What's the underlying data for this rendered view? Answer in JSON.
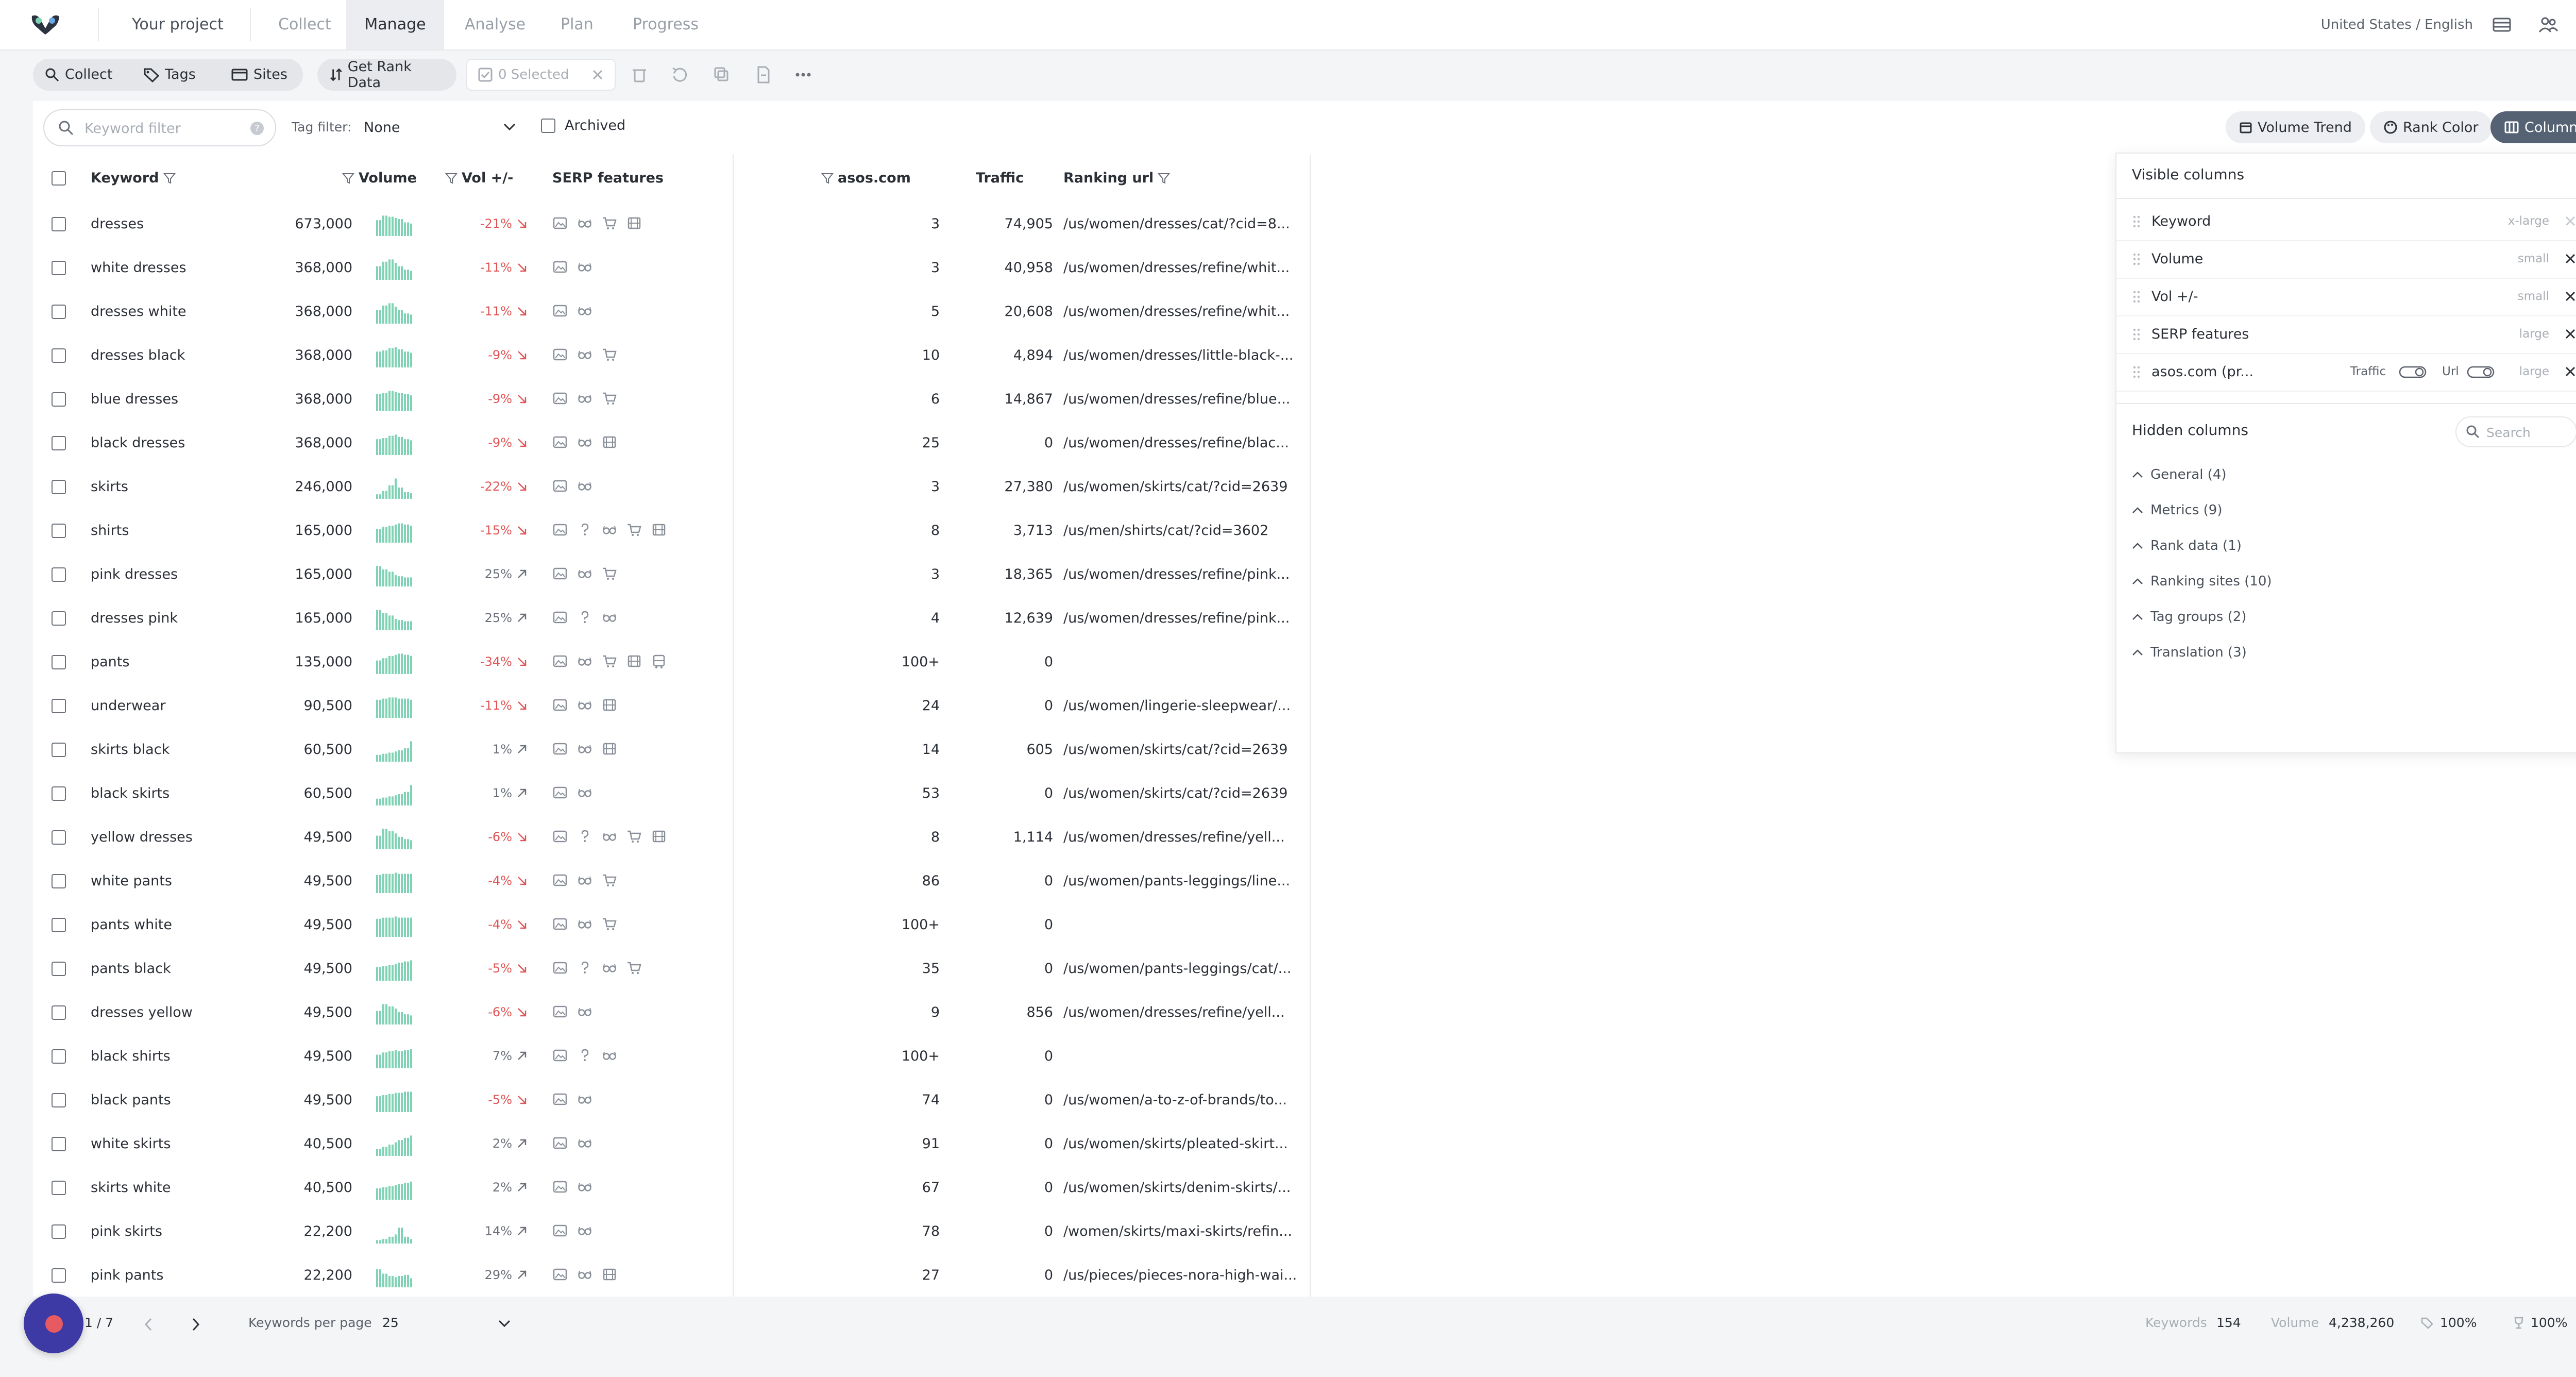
{
  "nav": {
    "project": "Your project",
    "items": [
      "Collect",
      "Manage",
      "Analyse",
      "Plan",
      "Progress"
    ],
    "active": "Manage",
    "locale": "United States / English"
  },
  "toolbar": {
    "collect": "Collect",
    "tags": "Tags",
    "sites": "Sites",
    "get_rank_data": "Get Rank Data",
    "selected": "0 Selected"
  },
  "filters": {
    "keyword_placeholder": "Keyword filter",
    "tag_filter_label": "Tag filter:",
    "tag_filter_value": "None",
    "archived_label": "Archived"
  },
  "right_buttons": {
    "volume_trend": "Volume Trend",
    "rank_color": "Rank Color",
    "columns": "Columns"
  },
  "table": {
    "headers": {
      "keyword": "Keyword",
      "volume": "Volume",
      "vol_change": "Vol +/-",
      "serp": "SERP features",
      "site": "asos.com",
      "traffic": "Traffic",
      "ranking_url": "Ranking url"
    },
    "rows": [
      {
        "kw": "dresses",
        "vol": "673,000",
        "chg": "-21%",
        "dir": "down",
        "serp": [
          "img",
          "glasses",
          "cart",
          "film"
        ],
        "rank": "3",
        "traffic": "74,905",
        "url": "/us/women/dresses/cat/?cid=8...",
        "spark": [
          0.7,
          0.9,
          0.85,
          0.8,
          0.75,
          0.6,
          0.55
        ]
      },
      {
        "kw": "white dresses",
        "vol": "368,000",
        "chg": "-11%",
        "dir": "down",
        "serp": [
          "img",
          "glasses"
        ],
        "rank": "3",
        "traffic": "40,958",
        "url": "/us/women/dresses/refine/whit...",
        "spark": [
          0.6,
          0.8,
          0.9,
          0.75,
          0.6,
          0.45,
          0.4
        ]
      },
      {
        "kw": "dresses white",
        "vol": "368,000",
        "chg": "-11%",
        "dir": "down",
        "serp": [
          "img",
          "glasses"
        ],
        "rank": "5",
        "traffic": "20,608",
        "url": "/us/women/dresses/refine/whit...",
        "spark": [
          0.6,
          0.8,
          0.9,
          0.75,
          0.6,
          0.45,
          0.4
        ]
      },
      {
        "kw": "dresses black",
        "vol": "368,000",
        "chg": "-9%",
        "dir": "down",
        "serp": [
          "img",
          "glasses",
          "cart"
        ],
        "rank": "10",
        "traffic": "4,894",
        "url": "/us/women/dresses/little-black-...",
        "spark": [
          0.7,
          0.75,
          0.85,
          0.9,
          0.8,
          0.7,
          0.65
        ]
      },
      {
        "kw": "blue dresses",
        "vol": "368,000",
        "chg": "-9%",
        "dir": "down",
        "serp": [
          "img",
          "glasses",
          "cart"
        ],
        "rank": "6",
        "traffic": "14,867",
        "url": "/us/women/dresses/refine/blue...",
        "spark": [
          0.75,
          0.8,
          0.9,
          0.85,
          0.8,
          0.75,
          0.7
        ]
      },
      {
        "kw": "black dresses",
        "vol": "368,000",
        "chg": "-9%",
        "dir": "down",
        "serp": [
          "img",
          "glasses",
          "film"
        ],
        "rank": "25",
        "traffic": "0",
        "url": "/us/women/dresses/refine/blac...",
        "spark": [
          0.7,
          0.75,
          0.85,
          0.9,
          0.8,
          0.7,
          0.65
        ]
      },
      {
        "kw": "skirts",
        "vol": "246,000",
        "chg": "-22%",
        "dir": "down",
        "serp": [
          "img",
          "glasses"
        ],
        "rank": "3",
        "traffic": "27,380",
        "url": "/us/women/skirts/cat/?cid=2639",
        "spark": [
          0.2,
          0.35,
          0.6,
          0.9,
          0.5,
          0.3,
          0.25
        ]
      },
      {
        "kw": "shirts",
        "vol": "165,000",
        "chg": "-15%",
        "dir": "down",
        "serp": [
          "img",
          "q",
          "glasses",
          "cart",
          "film"
        ],
        "rank": "8",
        "traffic": "3,713",
        "url": "/us/men/shirts/cat/?cid=3602",
        "spark": [
          0.6,
          0.7,
          0.75,
          0.8,
          0.85,
          0.8,
          0.75
        ]
      },
      {
        "kw": "pink dresses",
        "vol": "165,000",
        "chg": "25%",
        "dir": "up",
        "serp": [
          "img",
          "glasses",
          "cart"
        ],
        "rank": "3",
        "traffic": "18,365",
        "url": "/us/women/dresses/refine/pink...",
        "spark": [
          0.9,
          0.75,
          0.65,
          0.5,
          0.45,
          0.4,
          0.4
        ]
      },
      {
        "kw": "dresses pink",
        "vol": "165,000",
        "chg": "25%",
        "dir": "up",
        "serp": [
          "img",
          "q",
          "glasses"
        ],
        "rank": "4",
        "traffic": "12,639",
        "url": "/us/women/dresses/refine/pink...",
        "spark": [
          0.9,
          0.75,
          0.65,
          0.5,
          0.45,
          0.4,
          0.4
        ]
      },
      {
        "kw": "pants",
        "vol": "135,000",
        "chg": "-34%",
        "dir": "down",
        "serp": [
          "img",
          "glasses",
          "cart",
          "film",
          "bus"
        ],
        "rank": "100+",
        "traffic": "0",
        "url": "",
        "spark": [
          0.6,
          0.7,
          0.8,
          0.85,
          0.9,
          0.85,
          0.8
        ]
      },
      {
        "kw": "underwear",
        "vol": "90,500",
        "chg": "-11%",
        "dir": "down",
        "serp": [
          "img",
          "glasses",
          "film"
        ],
        "rank": "24",
        "traffic": "0",
        "url": "/us/women/lingerie-sleepwear/...",
        "spark": [
          0.8,
          0.85,
          0.9,
          0.9,
          0.85,
          0.85,
          0.8
        ]
      },
      {
        "kw": "skirts black",
        "vol": "60,500",
        "chg": "1%",
        "dir": "up",
        "serp": [
          "img",
          "glasses",
          "film"
        ],
        "rank": "14",
        "traffic": "605",
        "url": "/us/women/skirts/cat/?cid=2639",
        "spark": [
          0.3,
          0.35,
          0.4,
          0.45,
          0.5,
          0.6,
          0.9
        ]
      },
      {
        "kw": "black skirts",
        "vol": "60,500",
        "chg": "1%",
        "dir": "up",
        "serp": [
          "img",
          "glasses"
        ],
        "rank": "53",
        "traffic": "0",
        "url": "/us/women/skirts/cat/?cid=2639",
        "spark": [
          0.3,
          0.35,
          0.4,
          0.45,
          0.5,
          0.6,
          0.9
        ]
      },
      {
        "kw": "yellow dresses",
        "vol": "49,500",
        "chg": "-6%",
        "dir": "down",
        "serp": [
          "img",
          "q",
          "glasses",
          "cart",
          "film"
        ],
        "rank": "8",
        "traffic": "1,114",
        "url": "/us/women/dresses/refine/yell...",
        "spark": [
          0.6,
          0.9,
          0.8,
          0.7,
          0.55,
          0.45,
          0.4
        ]
      },
      {
        "kw": "white pants",
        "vol": "49,500",
        "chg": "-4%",
        "dir": "down",
        "serp": [
          "img",
          "glasses",
          "cart"
        ],
        "rank": "86",
        "traffic": "0",
        "url": "/us/women/pants-leggings/line...",
        "spark": [
          0.8,
          0.85,
          0.85,
          0.9,
          0.85,
          0.85,
          0.85
        ]
      },
      {
        "kw": "pants white",
        "vol": "49,500",
        "chg": "-4%",
        "dir": "down",
        "serp": [
          "img",
          "glasses",
          "cart"
        ],
        "rank": "100+",
        "traffic": "0",
        "url": "",
        "spark": [
          0.8,
          0.85,
          0.85,
          0.9,
          0.85,
          0.85,
          0.85
        ]
      },
      {
        "kw": "pants black",
        "vol": "49,500",
        "chg": "-5%",
        "dir": "down",
        "serp": [
          "img",
          "q",
          "glasses",
          "cart"
        ],
        "rank": "35",
        "traffic": "0",
        "url": "/us/women/pants-leggings/cat/...",
        "spark": [
          0.6,
          0.65,
          0.7,
          0.75,
          0.8,
          0.85,
          0.9
        ]
      },
      {
        "kw": "dresses yellow",
        "vol": "49,500",
        "chg": "-6%",
        "dir": "down",
        "serp": [
          "img",
          "glasses"
        ],
        "rank": "9",
        "traffic": "856",
        "url": "/us/women/dresses/refine/yell...",
        "spark": [
          0.6,
          0.9,
          0.8,
          0.7,
          0.55,
          0.45,
          0.4
        ]
      },
      {
        "kw": "black shirts",
        "vol": "49,500",
        "chg": "7%",
        "dir": "up",
        "serp": [
          "img",
          "q",
          "glasses"
        ],
        "rank": "100+",
        "traffic": "0",
        "url": "",
        "spark": [
          0.6,
          0.7,
          0.75,
          0.8,
          0.75,
          0.8,
          0.85
        ]
      },
      {
        "kw": "black pants",
        "vol": "49,500",
        "chg": "-5%",
        "dir": "down",
        "serp": [
          "img",
          "glasses"
        ],
        "rank": "74",
        "traffic": "0",
        "url": "/us/women/a-to-z-of-brands/to...",
        "spark": [
          0.7,
          0.75,
          0.8,
          0.85,
          0.85,
          0.9,
          0.9
        ]
      },
      {
        "kw": "white skirts",
        "vol": "40,500",
        "chg": "2%",
        "dir": "up",
        "serp": [
          "img",
          "glasses"
        ],
        "rank": "91",
        "traffic": "0",
        "url": "/us/women/skirts/pleated-skirt...",
        "spark": [
          0.3,
          0.4,
          0.5,
          0.6,
          0.7,
          0.8,
          0.9
        ]
      },
      {
        "kw": "skirts white",
        "vol": "40,500",
        "chg": "2%",
        "dir": "up",
        "serp": [
          "img",
          "glasses"
        ],
        "rank": "67",
        "traffic": "0",
        "url": "/us/women/skirts/denim-skirts/...",
        "spark": [
          0.5,
          0.55,
          0.6,
          0.65,
          0.7,
          0.75,
          0.8
        ]
      },
      {
        "kw": "pink skirts",
        "vol": "22,200",
        "chg": "14%",
        "dir": "up",
        "serp": [
          "img",
          "glasses"
        ],
        "rank": "78",
        "traffic": "0",
        "url": "/women/skirts/maxi-skirts/refin...",
        "spark": [
          0.15,
          0.2,
          0.3,
          0.4,
          0.7,
          0.3,
          0.2
        ]
      },
      {
        "kw": "pink pants",
        "vol": "22,200",
        "chg": "29%",
        "dir": "up",
        "serp": [
          "img",
          "glasses",
          "film"
        ],
        "rank": "27",
        "traffic": "0",
        "url": "/us/pieces/pieces-nora-high-wai...",
        "spark": [
          0.8,
          0.6,
          0.5,
          0.45,
          0.5,
          0.55,
          0.4
        ]
      }
    ]
  },
  "columns_panel": {
    "visible_title": "Visible columns",
    "visible": [
      {
        "name": "Keyword",
        "size": "x-large"
      },
      {
        "name": "Volume",
        "size": "small"
      },
      {
        "name": "Vol +/-",
        "size": "small"
      },
      {
        "name": "SERP features",
        "size": "large"
      },
      {
        "name": "asos.com (pr...",
        "size": "large",
        "traffic_label": "Traffic",
        "url_label": "Url"
      }
    ],
    "hidden_title": "Hidden columns",
    "search_placeholder": "Search",
    "groups": [
      "General (4)",
      "Metrics (9)",
      "Rank data (1)",
      "Ranking sites (10)",
      "Tag groups (2)",
      "Translation (3)"
    ]
  },
  "footer": {
    "page": "1 / 7",
    "per_page_label": "Keywords per page",
    "per_page_value": "25",
    "keywords_label": "Keywords",
    "keywords_value": "154",
    "volume_label": "Volume",
    "volume_value": "4,238,260",
    "pct1": "100%",
    "pct2": "100%"
  },
  "colors": {
    "spark": "#7fd3b4",
    "negative": "#e05555",
    "accent_dark": "#556274",
    "fab": "#3d3aa6"
  }
}
